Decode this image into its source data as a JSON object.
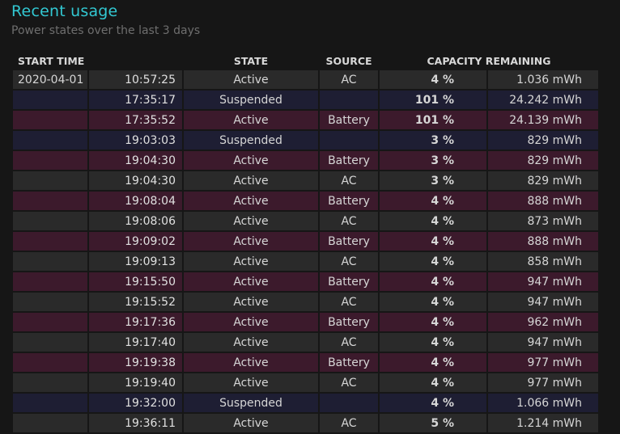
{
  "header": {
    "title": "Recent usage",
    "subtitle": "Power states over the last 3 days"
  },
  "table": {
    "columns": {
      "start_time": "START TIME",
      "state": "STATE",
      "source": "SOURCE",
      "capacity": "CAPACITY REMAINING"
    },
    "rows": [
      {
        "date": "2020-04-01",
        "time": "10:57:25",
        "state": "Active",
        "source": "AC",
        "percent": "4 %",
        "mwh": "1.036 mWh"
      },
      {
        "date": "",
        "time": "17:35:17",
        "state": "Suspended",
        "source": "",
        "percent": "101 %",
        "mwh": "24.242 mWh"
      },
      {
        "date": "",
        "time": "17:35:52",
        "state": "Active",
        "source": "Battery",
        "percent": "101 %",
        "mwh": "24.139 mWh"
      },
      {
        "date": "",
        "time": "19:03:03",
        "state": "Suspended",
        "source": "",
        "percent": "3 %",
        "mwh": "829 mWh"
      },
      {
        "date": "",
        "time": "19:04:30",
        "state": "Active",
        "source": "Battery",
        "percent": "3 %",
        "mwh": "829 mWh"
      },
      {
        "date": "",
        "time": "19:04:30",
        "state": "Active",
        "source": "AC",
        "percent": "3 %",
        "mwh": "829 mWh"
      },
      {
        "date": "",
        "time": "19:08:04",
        "state": "Active",
        "source": "Battery",
        "percent": "4 %",
        "mwh": "888 mWh"
      },
      {
        "date": "",
        "time": "19:08:06",
        "state": "Active",
        "source": "AC",
        "percent": "4 %",
        "mwh": "873 mWh"
      },
      {
        "date": "",
        "time": "19:09:02",
        "state": "Active",
        "source": "Battery",
        "percent": "4 %",
        "mwh": "888 mWh"
      },
      {
        "date": "",
        "time": "19:09:13",
        "state": "Active",
        "source": "AC",
        "percent": "4 %",
        "mwh": "858 mWh"
      },
      {
        "date": "",
        "time": "19:15:50",
        "state": "Active",
        "source": "Battery",
        "percent": "4 %",
        "mwh": "947 mWh"
      },
      {
        "date": "",
        "time": "19:15:52",
        "state": "Active",
        "source": "AC",
        "percent": "4 %",
        "mwh": "947 mWh"
      },
      {
        "date": "",
        "time": "19:17:36",
        "state": "Active",
        "source": "Battery",
        "percent": "4 %",
        "mwh": "962 mWh"
      },
      {
        "date": "",
        "time": "19:17:40",
        "state": "Active",
        "source": "AC",
        "percent": "4 %",
        "mwh": "947 mWh"
      },
      {
        "date": "",
        "time": "19:19:38",
        "state": "Active",
        "source": "Battery",
        "percent": "4 %",
        "mwh": "977 mWh"
      },
      {
        "date": "",
        "time": "19:19:40",
        "state": "Active",
        "source": "AC",
        "percent": "4 %",
        "mwh": "977 mWh"
      },
      {
        "date": "",
        "time": "19:32:00",
        "state": "Suspended",
        "source": "",
        "percent": "4 %",
        "mwh": "1.066 mWh"
      },
      {
        "date": "",
        "time": "19:36:11",
        "state": "Active",
        "source": "AC",
        "percent": "5 %",
        "mwh": "1.214 mWh"
      }
    ]
  }
}
